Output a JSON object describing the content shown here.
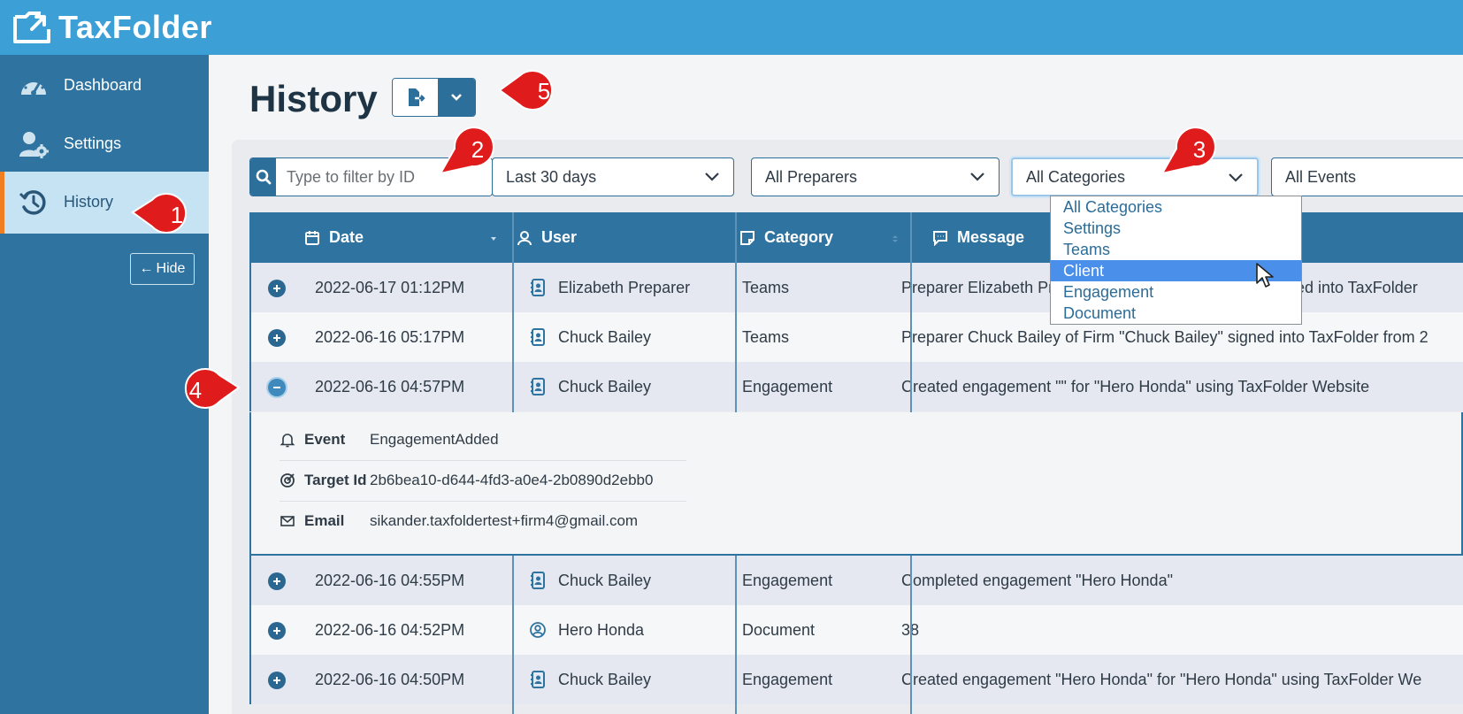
{
  "app": {
    "brand": "TaxFolder",
    "brand_color": "#3c9fd5",
    "sidebar_color": "#2f73a0",
    "accent": "#ef7f22"
  },
  "sidebar": {
    "items": [
      {
        "label": "Dashboard",
        "icon": "gauge-icon",
        "active": false
      },
      {
        "label": "Settings",
        "icon": "user-gear-icon",
        "active": false
      },
      {
        "label": "History",
        "icon": "history-icon",
        "active": true
      }
    ],
    "hide_label": "Hide"
  },
  "page": {
    "title": "History"
  },
  "filters": {
    "search_placeholder": "Type to filter by ID",
    "date_range": "Last 30 days",
    "preparers": "All Preparers",
    "categories": "All Categories",
    "events": "All Events",
    "category_options": [
      "All Categories",
      "Settings",
      "Teams",
      "Client",
      "Engagement",
      "Document"
    ],
    "highlighted_option": "Client"
  },
  "table": {
    "columns": [
      "Date",
      "User",
      "Category",
      "Message"
    ],
    "rows": [
      {
        "date": "2022-06-17 01:12PM",
        "user": "Elizabeth Preparer",
        "user_type": "preparer",
        "category": "Teams",
        "message": "Preparer Elizabeth Preparer of Firm \"Chuck Bailey\" signed into TaxFolder"
      },
      {
        "date": "2022-06-16 05:17PM",
        "user": "Chuck Bailey",
        "user_type": "preparer",
        "category": "Teams",
        "message": "Preparer Chuck Bailey of Firm \"Chuck Bailey\" signed into TaxFolder from 2"
      },
      {
        "date": "2022-06-16 04:57PM",
        "user": "Chuck Bailey",
        "user_type": "preparer",
        "category": "Engagement",
        "message": "Created engagement \"\" for \"Hero Honda\" using TaxFolder Website",
        "expanded": true
      },
      {
        "date": "2022-06-16 04:55PM",
        "user": "Chuck Bailey",
        "user_type": "preparer",
        "category": "Engagement",
        "message": "Completed engagement \"Hero Honda\""
      },
      {
        "date": "2022-06-16 04:52PM",
        "user": "Hero Honda",
        "user_type": "client",
        "category": "Document",
        "message": "38"
      },
      {
        "date": "2022-06-16 04:50PM",
        "user": "Chuck Bailey",
        "user_type": "preparer",
        "category": "Engagement",
        "message": "Created engagement \"Hero Honda\" for \"Hero Honda\" using TaxFolder We"
      }
    ],
    "detail": {
      "event_label": "Event",
      "event_value": "EngagementAdded",
      "target_label": "Target Id",
      "target_value": "2b6bea10-d644-4fd3-a0e4-2b0890d2ebb0",
      "email_label": "Email",
      "email_value": "sikander.taxfoldertest+firm4@gmail.com"
    }
  },
  "callouts": [
    "1",
    "2",
    "3",
    "4",
    "5"
  ]
}
